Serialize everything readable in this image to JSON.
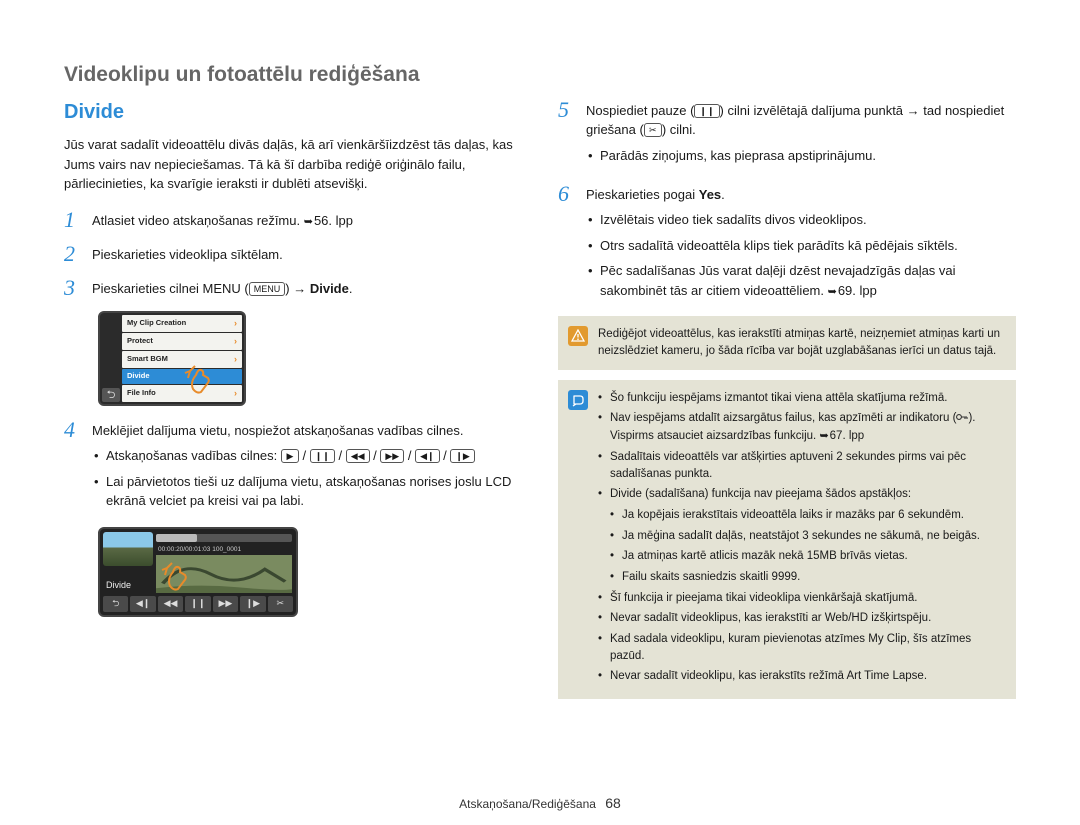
{
  "page_title": "Videoklipu un fotoattēlu rediģēšana",
  "section_title": "Divide",
  "intro": "Jūs varat sadalīt videoattēlu divās daļās, kā arī vienkāršīizdzēst tās daļas, kas Jums vairs nav nepieciešamas. Tā kā šī darbība rediģē oriģinālo failu, pārliecinieties, ka svarīgie ieraksti ir dublēti atsevišķi.",
  "steps": {
    "s1": {
      "num": "1",
      "text_a": "Atlasiet video atskaņošanas režīmu. ",
      "ref": "56. lpp"
    },
    "s2": {
      "num": "2",
      "text": "Pieskarieties videoklipa sīktēlam."
    },
    "s3": {
      "num": "3",
      "text_a": "Pieskarieties cilnei MENU (",
      "menu_key": "MENU",
      "text_b": ") ",
      "arrow": "→",
      "bold": "Divide",
      "text_c": "."
    },
    "s4": {
      "num": "4",
      "text": "Meklējiet dalījuma vietu, nospiežot atskaņošanas vadības cilnes.",
      "sub1": "Atskaņošanas vadības cilnes:",
      "sub2": "Lai pārvietotos tieši uz dalījuma vietu, atskaņošanas norises joslu LCD ekrānā velciet pa kreisi vai pa labi."
    },
    "s5": {
      "num": "5",
      "text_a": "Nospiediet pauze (",
      "text_b": ") cilni izvēlētajā dalījuma punktā ",
      "arrow": "→",
      "text_c": " tad nospiediet griešana (",
      "text_d": ") cilni.",
      "sub1": "Parādās ziņojums, kas pieprasa apstiprinājumu."
    },
    "s6": {
      "num": "6",
      "text_a": "Pieskarieties pogai ",
      "bold": "Yes",
      "text_b": ".",
      "sub1": "Izvēlētais video tiek sadalīts divos videoklipos.",
      "sub2": "Otrs sadalītā videoattēla klips tiek parādīts kā pēdējais sīktēls.",
      "sub3_a": "Pēc sadalīšanas Jūs varat daļēji dzēst nevajadzīgās daļas vai sakombinēt tās ar citiem videoattēliem. ",
      "sub3_ref": "69. lpp"
    }
  },
  "menu_screenshot": {
    "items": [
      "My Clip Creation",
      "Protect",
      "Smart BGM",
      "Divide",
      "File Info"
    ],
    "active_idx": 3
  },
  "timeline_screenshot": {
    "timecode": "00:00:20/00:01:03  100_0001",
    "label": "Divide"
  },
  "warn_note": "Rediģējot videoattēlus, kas ierakstīti atmiņas kartē, neizņemiet atmiņas karti un neizslēdziet kameru, jo šāda rīcība var bojāt uzglabāšanas ierīci un datus tajā.",
  "info_note": {
    "b1": "Šo funkciju iespējams izmantot tikai viena attēla skatījuma režīmā.",
    "b2_a": "Nav iespējams atdalīt aizsargātus failus, kas apzīmēti ar indikatoru (",
    "b2_b": ").  Vispirms atsauciet aizsardzības funkciju. ",
    "b2_ref": "67. lpp",
    "b3": "Sadalītais videoattēls var atšķirties aptuveni 2 sekundes pirms vai pēc sadalīšanas punkta.",
    "b4": "Divide (sadalīšana) funkcija nav pieejama šādos apstākļos:",
    "b4_n1": "Ja kopējais ierakstītais videoattēla laiks ir mazāks par 6 sekundēm.",
    "b4_n2": "Ja mēģina sadalīt daļās, neatstājot 3 sekundes ne sākumā, ne beigās.",
    "b4_n3": "Ja atmiņas kartē atlicis mazāk nekā 15MB brīvās vietas.",
    "b4_n4": "Failu skaits sasniedzis skaitli 9999.",
    "b5": "Šī funkcija ir pieejama tikai videoklipa vienkāršajā skatījumā.",
    "b6": "Nevar sadalīt videoklipus, kas ierakstīti ar Web/HD izšķirtspēju.",
    "b7": "Kad sadala videoklipu, kuram pievienotas atzīmes My Clip, šīs atzīmes pazūd.",
    "b8": "Nevar sadalīt videoklipu, kas ierakstīts režīmā Art Time Lapse."
  },
  "footer_text": "Atskaņošana/Rediģēšana",
  "page_number": "68"
}
